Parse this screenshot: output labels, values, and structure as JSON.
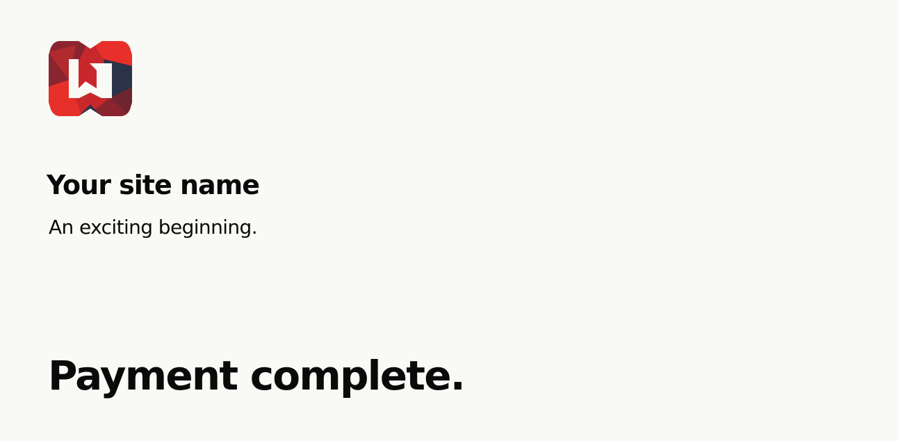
{
  "header": {
    "logo": {
      "icon": "site-logo-icon",
      "colors": [
        "#e8302a",
        "#8a2530",
        "#2b3348",
        "#c8282c"
      ]
    },
    "site_name": "Your site name",
    "tagline": "An exciting beginning."
  },
  "main": {
    "title": "Payment complete."
  },
  "theme": {
    "background": "#f9f9f5",
    "text": "#0a0a0a"
  }
}
